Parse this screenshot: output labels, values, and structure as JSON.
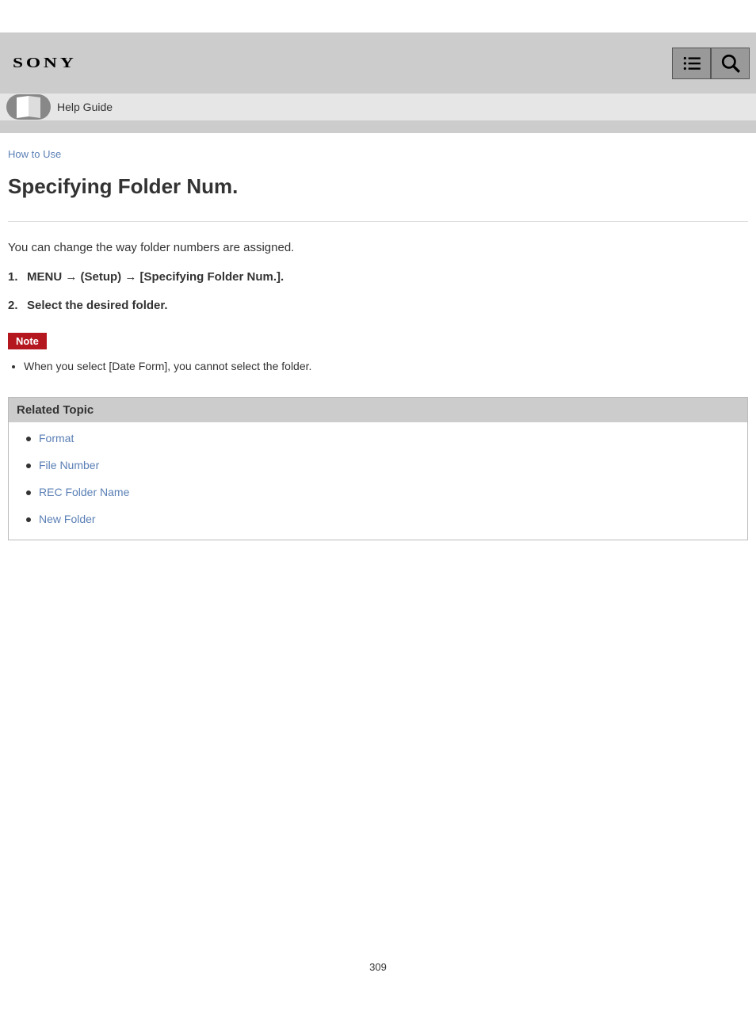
{
  "header": {
    "logo": "SONY"
  },
  "product": {
    "label": "Help Guide"
  },
  "content": {
    "top_link": "How to Use",
    "title": "Specifying Folder Num.",
    "intro": "You can change the way folder numbers are assigned.",
    "steps": [
      "MENU → (Setup) → [Specifying Folder Num.].",
      "Select the desired folder."
    ],
    "note_label": "Note",
    "note_items": [
      "When you select [Date Form], you cannot select the folder."
    ],
    "related_header": "Related Topic",
    "related_items": [
      "Format",
      "File Number",
      "REC Folder Name",
      "New Folder"
    ]
  },
  "page_number": "309"
}
